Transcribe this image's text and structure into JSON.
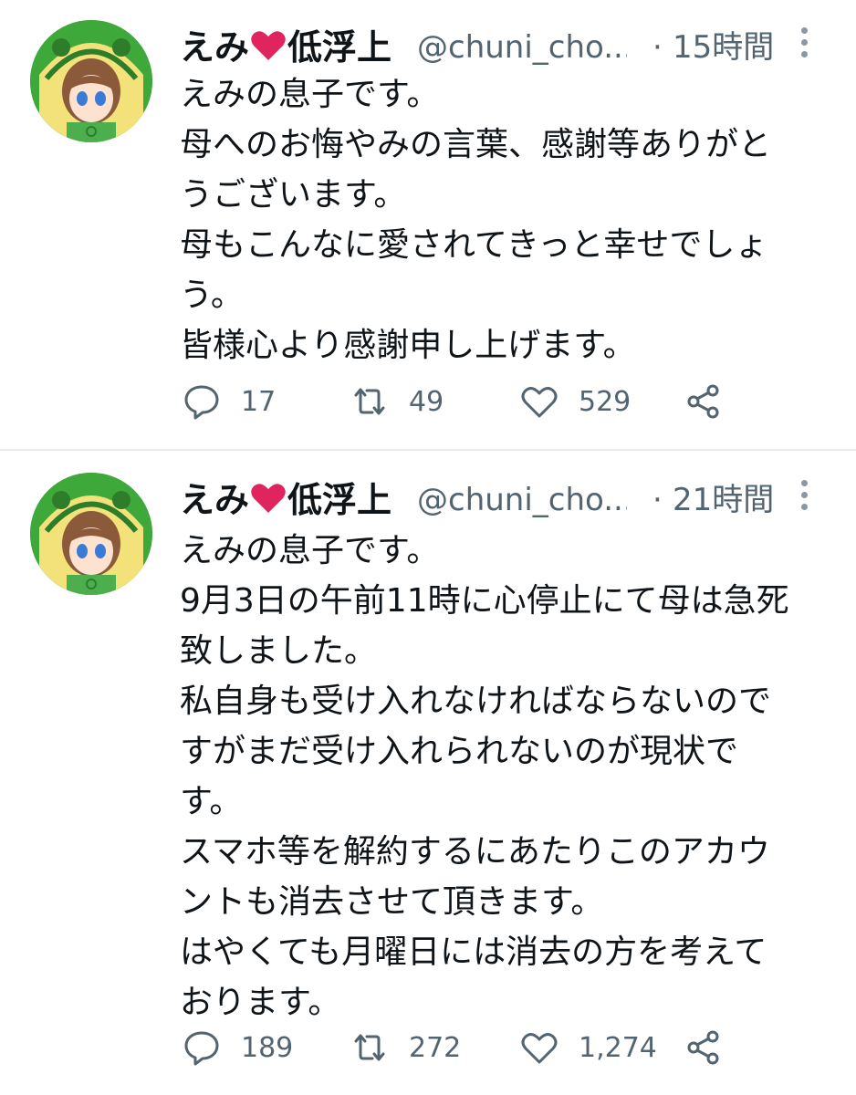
{
  "tweets": [
    {
      "author_name_before_heart": "えみ",
      "author_name_after_heart": "低浮上",
      "handle": "@chuni_cho...",
      "separator": "·",
      "time": "15時間",
      "lines": [
        "えみの息子です。",
        "母へのお悔やみの言葉、感謝等ありがと",
        "うございます。",
        "母もこんなに愛されてきっと幸せでしょ",
        "う。",
        "皆様心より感謝申し上げます。"
      ],
      "reply_count": "17",
      "retweet_count": "49",
      "like_count": "529"
    },
    {
      "author_name_before_heart": "えみ",
      "author_name_after_heart": "低浮上",
      "handle": "@chuni_cho...",
      "separator": "·",
      "time": "21時間",
      "lines": [
        "えみの息子です。",
        "9月3日の午前11時に心停止にて母は急死",
        "致しました。",
        "私自身も受け入れなければならないので",
        "すがまだ受け入れられないのが現状で",
        "す。",
        "スマホ等を解約するにあたりこのアカウ",
        "ントも消去させて頂きます。",
        "はやくても月曜日には消去の方を考えて",
        "おります。"
      ],
      "reply_count": "189",
      "retweet_count": "272",
      "like_count": "1,274"
    }
  ],
  "icons": {
    "heart_emoji": "heart-emoji-icon",
    "more": "more-vertical-icon",
    "reply": "reply-icon",
    "retweet": "retweet-icon",
    "like": "like-icon",
    "share": "share-icon"
  },
  "colors": {
    "text": "#0f1419",
    "secondary": "#536471",
    "heart": "#e0245e",
    "divider": "#e6ecf0",
    "avatar_bg": "#3fa83a"
  }
}
